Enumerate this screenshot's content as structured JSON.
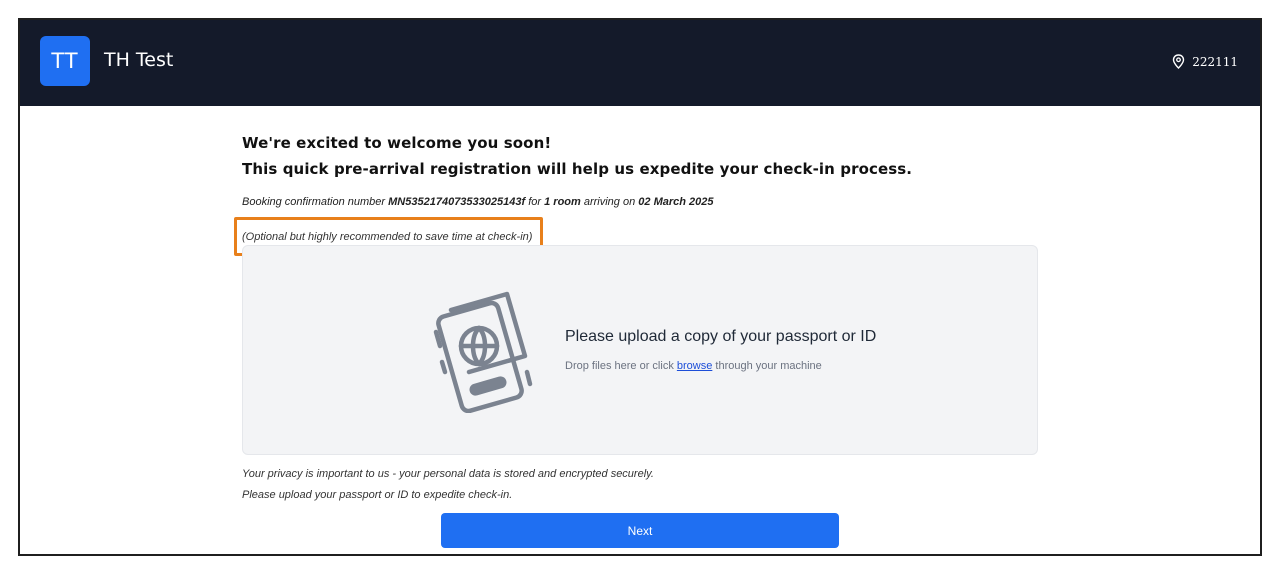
{
  "header": {
    "logo_initials": "TT",
    "brand_name": "TH Test",
    "location_icon": "map-pin-icon",
    "location_code": "222111"
  },
  "intro": {
    "line1": "We're excited to welcome you soon!",
    "line2": "This quick pre-arrival registration will help us expedite your check-in process."
  },
  "booking": {
    "prefix": "Booking confirmation number ",
    "number": "MN5352174073533025143f",
    "mid": " for ",
    "rooms": "1 room",
    "arriving": " arriving on ",
    "date": "02 March 2025"
  },
  "optional_note": "(Optional but highly recommended to save time at check-in)",
  "upload": {
    "icon": "passport-icon",
    "title": "Please upload a copy of your passport or ID",
    "hint_prefix": "Drop files here or click ",
    "hint_link": "browse",
    "hint_suffix": " through your machine"
  },
  "privacy": {
    "line1": "Your privacy is important to us - your personal data is stored and encrypted securely.",
    "line2": "Please upload your passport or ID to expedite check-in."
  },
  "next_button": "Next",
  "colors": {
    "header_bg": "#141a2a",
    "accent": "#1f6ff2",
    "highlight": "#e8801b"
  }
}
